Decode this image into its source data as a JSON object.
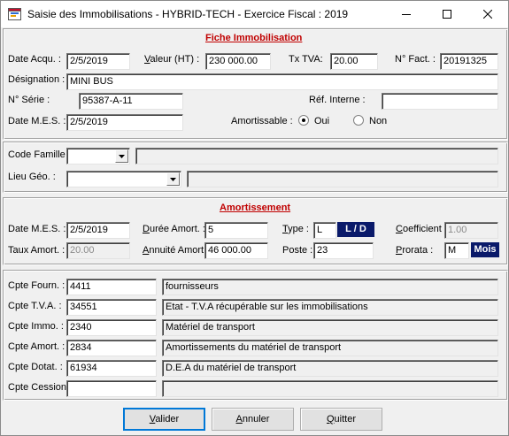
{
  "window": {
    "title": "Saisie des Immobilisations - HYBRID-TECH - Exercice Fiscal : 2019",
    "icon": "app-icon",
    "minimize": "minimize-icon",
    "maximize": "maximize-icon",
    "close": "close-icon"
  },
  "fiche": {
    "section_title": "Fiche Immobilisation",
    "date_acqu_label": "Date Acqu. :",
    "date_acqu": "2/5/2019",
    "valeur_label_pre": "V",
    "valeur_label_rest": "aleur (HT) :",
    "valeur": "230 000.00",
    "tx_tva_label": "Tx TVA:",
    "tx_tva": "20.00",
    "n_fact_label": "N° Fact. :",
    "n_fact": "20191325",
    "designation_label": "Désignation :",
    "designation": "MINI BUS",
    "n_serie_label": "N° Série :",
    "n_serie": "95387-A-11",
    "ref_interne_label": "Réf. Interne :",
    "ref_interne": "",
    "date_mes_label": "Date M.E.S. :",
    "date_mes": "2/5/2019",
    "amortissable_label": "Amortissable :",
    "oui": "Oui",
    "non": "Non",
    "amortissable_value": "Oui"
  },
  "famille": {
    "code_famille_label": "Code Famille :",
    "code_famille": "",
    "code_famille_desc": "",
    "lieu_geo_label": "Lieu Géo. :",
    "lieu_geo": "",
    "lieu_geo_desc": ""
  },
  "amort": {
    "section_title": "Amortissement",
    "date_mes_label": "Date M.E.S. :",
    "date_mes": "2/5/2019",
    "duree_label_pre": "D",
    "duree_label_rest": "urée Amort. :",
    "duree": "5",
    "type_label_pre": "T",
    "type_label_rest": "ype :",
    "type": "L",
    "type_badge": "L / D",
    "coef_label_pre": "C",
    "coef_label_rest": "oefficient :",
    "coef": "1.00",
    "taux_label": "Taux Amort. :",
    "taux": "20.00",
    "annuite_label_pre": "A",
    "annuite_label_rest": "nnuité Amort :",
    "annuite": "46 000.00",
    "poste_label": "Poste :",
    "poste": "23",
    "prorata_label_pre": "P",
    "prorata_label_rest": "rorata :",
    "prorata": "M",
    "prorata_badge": "Mois"
  },
  "comptes": [
    {
      "label": "Cpte Fourn. :",
      "code": "4411",
      "desc": "fournisseurs"
    },
    {
      "label": "Cpte T.V.A. :",
      "code": "34551",
      "desc": "Etat - T.V.A récupérable sur les immobilisations"
    },
    {
      "label": "Cpte Immo. :",
      "code": "2340",
      "desc": "Matériel de transport"
    },
    {
      "label": "Cpte Amort. :",
      "code": "2834",
      "desc": "Amortissements du matériel de transport"
    },
    {
      "label": "Cpte Dotat. :",
      "code": "61934",
      "desc": "D.E.A du matériel de transport"
    },
    {
      "label": "Cpte Cession :",
      "code": "",
      "desc": ""
    }
  ],
  "buttons": {
    "valider_pre": "V",
    "valider_rest": "alider",
    "annuler_pre": "A",
    "annuler_rest": "nnuler",
    "quitter_pre": "Q",
    "quitter_rest": "uitter"
  }
}
